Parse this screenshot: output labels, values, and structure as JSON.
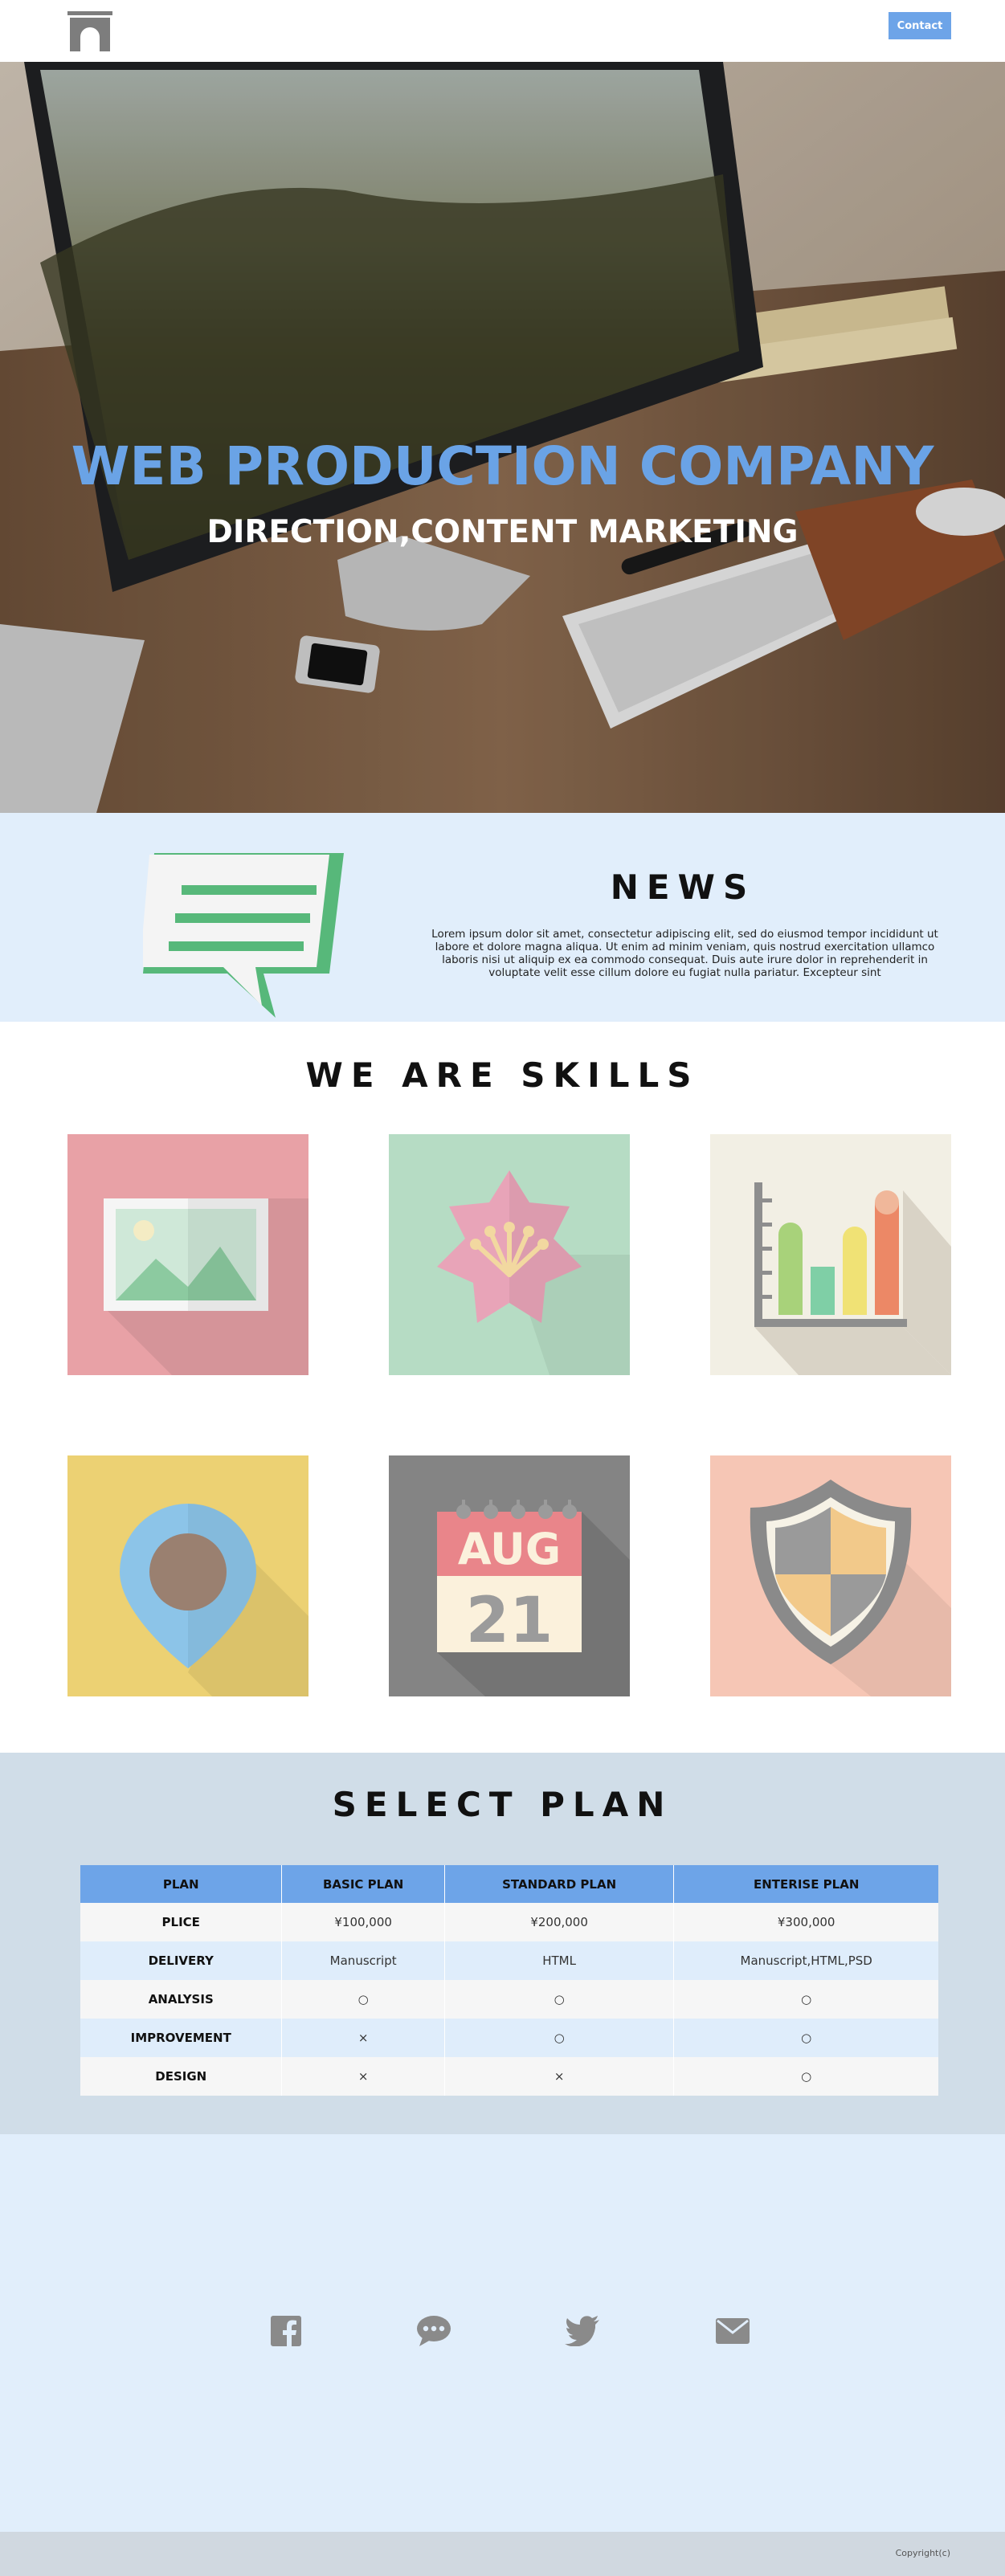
{
  "header": {
    "contact_label": "Contact"
  },
  "hero": {
    "title": "WEB PRODUCTION COMPANY",
    "subtitle": "DIRECTION,CONTENT MARKETING"
  },
  "news": {
    "title": "NEWS",
    "text": "Lorem ipsum dolor sit amet, consectetur adipiscing elit, sed do eiusmod tempor incididunt ut labore et dolore magna aliqua. Ut enim ad minim veniam, quis nostrud exercitation ullamco laboris nisi ut aliquip ex ea commodo consequat. Duis aute irure dolor in reprehenderit in voluptate velit esse cillum dolore eu fugiat nulla pariatur. Excepteur sint"
  },
  "skills": {
    "title": "WE ARE SKILLS",
    "calendar_month": "AUG",
    "calendar_day": "21",
    "tiles": [
      {
        "icon": "image-icon",
        "bg": "#e8a1a6"
      },
      {
        "icon": "flower-icon",
        "bg": "#b6dcc4"
      },
      {
        "icon": "bar-chart-icon",
        "bg": "#f2efe4"
      },
      {
        "icon": "map-pin-icon",
        "bg": "#ecd173"
      },
      {
        "icon": "calendar-icon",
        "bg": "#848484"
      },
      {
        "icon": "shield-icon",
        "bg": "#f6c6b5"
      }
    ]
  },
  "plans": {
    "title": "SELECT PLAN",
    "headers": [
      "PLAN",
      "BASIC PLAN",
      "STANDARD PLAN",
      "ENTERISE PLAN"
    ],
    "rows": [
      [
        "PLICE",
        "¥100,000",
        "¥200,000",
        "¥300,000"
      ],
      [
        "DELIVERY",
        "Manuscript",
        "HTML",
        "Manuscript,HTML,PSD"
      ],
      [
        "ANALYSIS",
        "○",
        "○",
        "○"
      ],
      [
        "IMPROVEMENT",
        "×",
        "○",
        "○"
      ],
      [
        "DESIGN",
        "×",
        "×",
        "○"
      ]
    ]
  },
  "social": {
    "icons": [
      "facebook-icon",
      "chat-icon",
      "twitter-icon",
      "mail-icon"
    ]
  },
  "footer": {
    "copyright": "Copyright(c)"
  },
  "colors": {
    "accent": "#6da4e8",
    "light_bg": "#e1eefb",
    "plan_bg": "#d0dde8",
    "icon_gray": "#8a8a8a"
  }
}
